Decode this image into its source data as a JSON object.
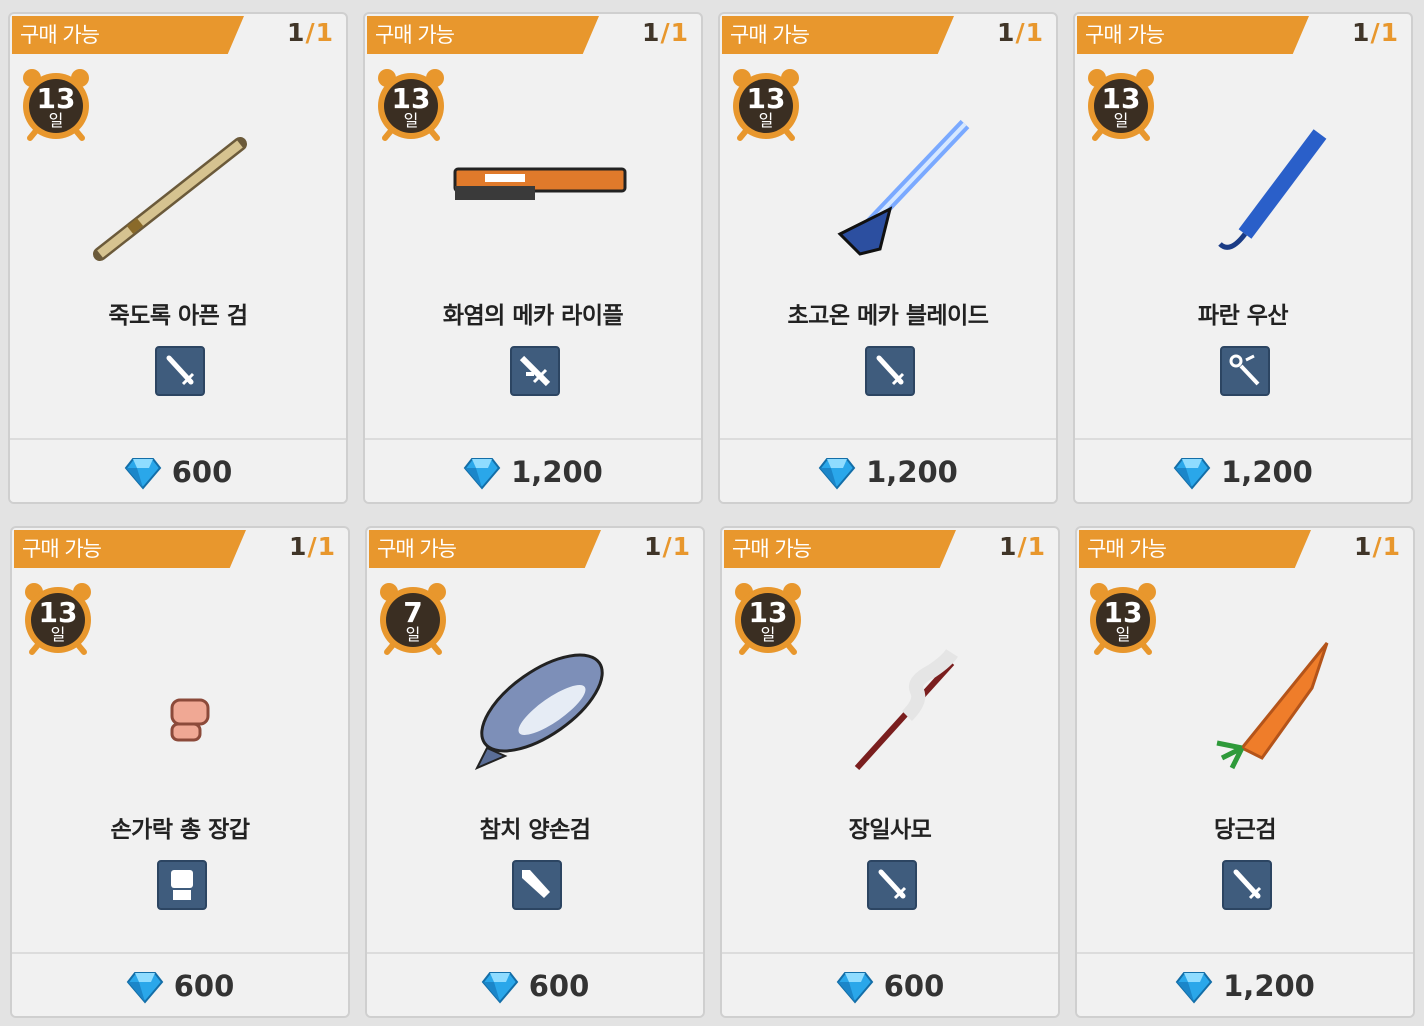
{
  "shop": {
    "items": [
      {
        "badge": "구매 가능",
        "stock_current": "1",
        "stock_sep": "/",
        "stock_max": "1",
        "days": "13",
        "days_unit": "일",
        "name": "죽도록 아픈 검",
        "type_icon": "sword-icon",
        "price": "600",
        "art": "bamboo-sword"
      },
      {
        "badge": "구매 가능",
        "stock_current": "1",
        "stock_sep": "/",
        "stock_max": "1",
        "days": "13",
        "days_unit": "일",
        "name": "화염의 메카 라이플",
        "type_icon": "rifle-icon",
        "price": "1,200",
        "art": "mecha-rifle"
      },
      {
        "badge": "구매 가능",
        "stock_current": "1",
        "stock_sep": "/",
        "stock_max": "1",
        "days": "13",
        "days_unit": "일",
        "name": "초고온 메카 블레이드",
        "type_icon": "sword-icon",
        "price": "1,200",
        "art": "mecha-blade"
      },
      {
        "badge": "구매 가능",
        "stock_current": "1",
        "stock_sep": "/",
        "stock_max": "1",
        "days": "13",
        "days_unit": "일",
        "name": "파란 우산",
        "type_icon": "wand-icon",
        "price": "1,200",
        "art": "blue-umbrella"
      },
      {
        "badge": "구매 가능",
        "stock_current": "1",
        "stock_sep": "/",
        "stock_max": "1",
        "days": "13",
        "days_unit": "일",
        "name": "손가락 총 장갑",
        "type_icon": "fist-icon",
        "price": "600",
        "art": "finger-gun-glove"
      },
      {
        "badge": "구매 가능",
        "stock_current": "1",
        "stock_sep": "/",
        "stock_max": "1",
        "days": "7",
        "days_unit": "일",
        "name": "참치 양손검",
        "type_icon": "greatsword-icon",
        "price": "600",
        "art": "tuna"
      },
      {
        "badge": "구매 가능",
        "stock_current": "1",
        "stock_sep": "/",
        "stock_max": "1",
        "days": "13",
        "days_unit": "일",
        "name": "장일사모",
        "type_icon": "sword-icon",
        "price": "600",
        "art": "serpent-spear"
      },
      {
        "badge": "구매 가능",
        "stock_current": "1",
        "stock_sep": "/",
        "stock_max": "1",
        "days": "13",
        "days_unit": "일",
        "name": "당근검",
        "type_icon": "sword-icon",
        "price": "1,200",
        "art": "carrot-sword"
      }
    ]
  },
  "colors": {
    "badge": "#e8972d",
    "type_icon_bg": "#3f5c7d",
    "timer": "#e8972d",
    "timer_face": "#3a2e22",
    "gem": "#2aa7ea"
  }
}
